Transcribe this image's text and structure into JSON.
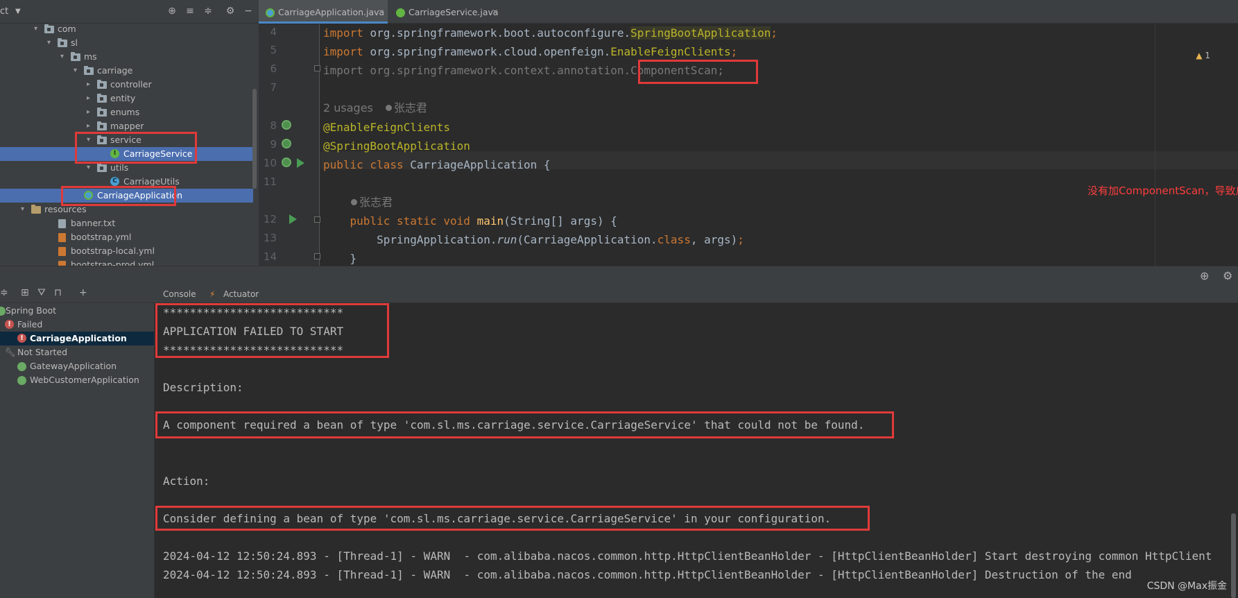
{
  "project": {
    "title": "ct",
    "tree": [
      {
        "label": "com",
        "kind": "package",
        "indent": 0,
        "expanded": true
      },
      {
        "label": "sl",
        "kind": "package",
        "indent": 1,
        "expanded": true
      },
      {
        "label": "ms",
        "kind": "package",
        "indent": 2,
        "expanded": true
      },
      {
        "label": "carriage",
        "kind": "package",
        "indent": 3,
        "expanded": true
      },
      {
        "label": "controller",
        "kind": "package",
        "indent": 4,
        "expanded": false
      },
      {
        "label": "entity",
        "kind": "package",
        "indent": 4,
        "expanded": false
      },
      {
        "label": "enums",
        "kind": "package",
        "indent": 4,
        "expanded": false
      },
      {
        "label": "mapper",
        "kind": "package",
        "indent": 4,
        "expanded": false
      },
      {
        "label": "service",
        "kind": "package",
        "indent": 4,
        "expanded": true
      },
      {
        "label": "CarriageService",
        "kind": "interface",
        "indent": 5,
        "selected": true
      },
      {
        "label": "utils",
        "kind": "package",
        "indent": 4,
        "expanded": true
      },
      {
        "label": "CarriageUtils",
        "kind": "class",
        "indent": 5
      },
      {
        "label": "CarriageApplication",
        "kind": "springboot",
        "indent": 3,
        "selected": true
      },
      {
        "label": "resources",
        "kind": "resources",
        "indent": -1,
        "expanded": true
      },
      {
        "label": "banner.txt",
        "kind": "file",
        "indent": 1
      },
      {
        "label": "bootstrap.yml",
        "kind": "yml",
        "indent": 1
      },
      {
        "label": "bootstrap-local.yml",
        "kind": "yml",
        "indent": 1
      },
      {
        "label": "bootstrap-prod.yml",
        "kind": "yml",
        "indent": 1
      }
    ]
  },
  "tabs": [
    {
      "label": "CarriageApplication.java",
      "active": true,
      "icon_color": "#4a9ed1"
    },
    {
      "label": "CarriageService.java",
      "active": false,
      "icon_color": "#62b543"
    }
  ],
  "editor": {
    "warning_count": "1",
    "lines": [
      {
        "n": "4",
        "text": "import org.springframework.boot.autoconfigure.SpringBootApplication;"
      },
      {
        "n": "5",
        "text": "import org.springframework.cloud.openfeign.EnableFeignClients;"
      },
      {
        "n": "6",
        "text": "import org.springframework.context.annotation.ComponentScan;"
      },
      {
        "n": "7",
        "text": ""
      },
      {
        "n": "8",
        "text": "@EnableFeignClients"
      },
      {
        "n": "9",
        "text": "@SpringBootApplication"
      },
      {
        "n": "10",
        "text": "public class CarriageApplication {"
      },
      {
        "n": "11",
        "text": ""
      },
      {
        "n": "12",
        "text": "    public static void main(String[] args) {"
      },
      {
        "n": "13",
        "text": "        SpringApplication.run(CarriageApplication.class, args);"
      },
      {
        "n": "14",
        "text": "    }"
      }
    ],
    "hint_usages": "2 usages",
    "hint_author": "张志君",
    "annotation_note": "没有加ComponentScan，导致启动失败"
  },
  "services": {
    "items": [
      {
        "label": "Spring Boot",
        "kind": "root"
      },
      {
        "label": "Failed",
        "kind": "failed-group"
      },
      {
        "label": "CarriageApplication",
        "kind": "failed-app",
        "selected": true
      },
      {
        "label": "Not Started",
        "kind": "group"
      },
      {
        "label": "GatewayApplication",
        "kind": "app"
      },
      {
        "label": "WebCustomerApplication",
        "kind": "app"
      }
    ]
  },
  "console_tabs": [
    "Console",
    "Actuator"
  ],
  "console": {
    "lines": [
      "***************************",
      "APPLICATION FAILED TO START",
      "***************************",
      "",
      "Description:",
      "",
      "A component required a bean of type 'com.sl.ms.carriage.service.CarriageService' that could not be found.",
      "",
      "",
      "Action:",
      "",
      "Consider defining a bean of type 'com.sl.ms.carriage.service.CarriageService' in your configuration.",
      "",
      "2024-04-12 12:50:24.893 - [Thread-1] - WARN  - com.alibaba.nacos.common.http.HttpClientBeanHolder - [HttpClientBeanHolder] Start destroying common HttpClient",
      "2024-04-12 12:50:24.893 - [Thread-1] - WARN  - com.alibaba.nacos.common.http.HttpClientBeanHolder - [HttpClientBeanHolder] Destruction of the end"
    ]
  },
  "watermark": "CSDN @Max振金",
  "colors": {
    "highlight_box": "#e03a3a",
    "selection": "#4b6eaf",
    "note": "#ff3d3d"
  }
}
